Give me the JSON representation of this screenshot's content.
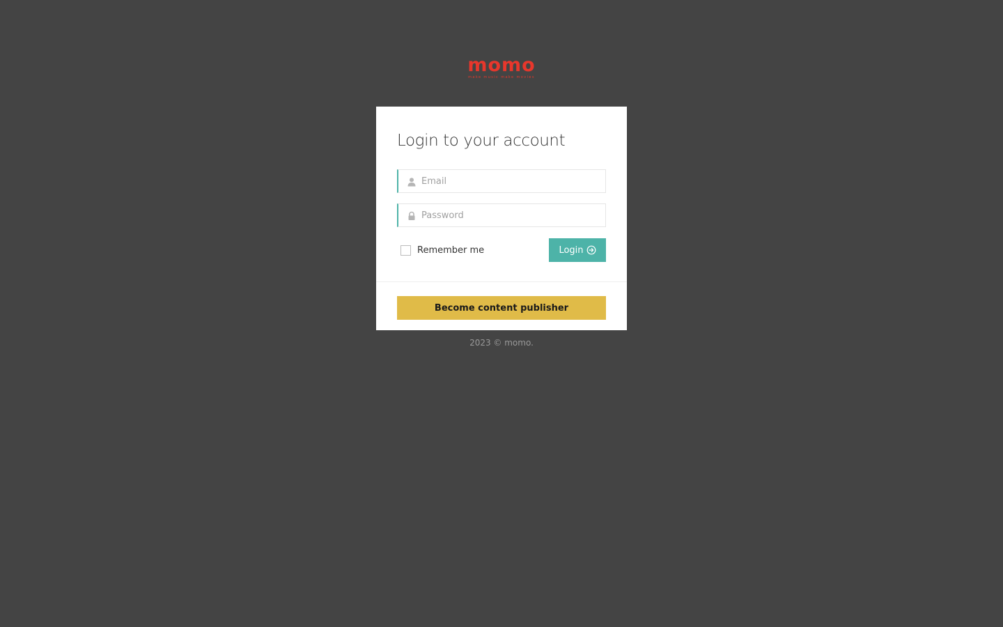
{
  "brand": {
    "logo_text": "momo",
    "tagline": "make music make movies",
    "color": "#e8372c"
  },
  "login": {
    "title": "Login to your account",
    "email_placeholder": "Email",
    "password_placeholder": "Password",
    "remember_label": "Remember me",
    "remember_checked": false,
    "login_label": "Login",
    "email_icon": "user-icon",
    "password_icon": "lock-icon",
    "login_icon": "arrow-circle-right-icon"
  },
  "publisher": {
    "button_label": "Become content publisher"
  },
  "footer": {
    "text": "2023 © momo."
  },
  "colors": {
    "background": "#444444",
    "accent": "#4db3a8",
    "publisher_button": "#e0bb48",
    "card": "#ffffff"
  }
}
